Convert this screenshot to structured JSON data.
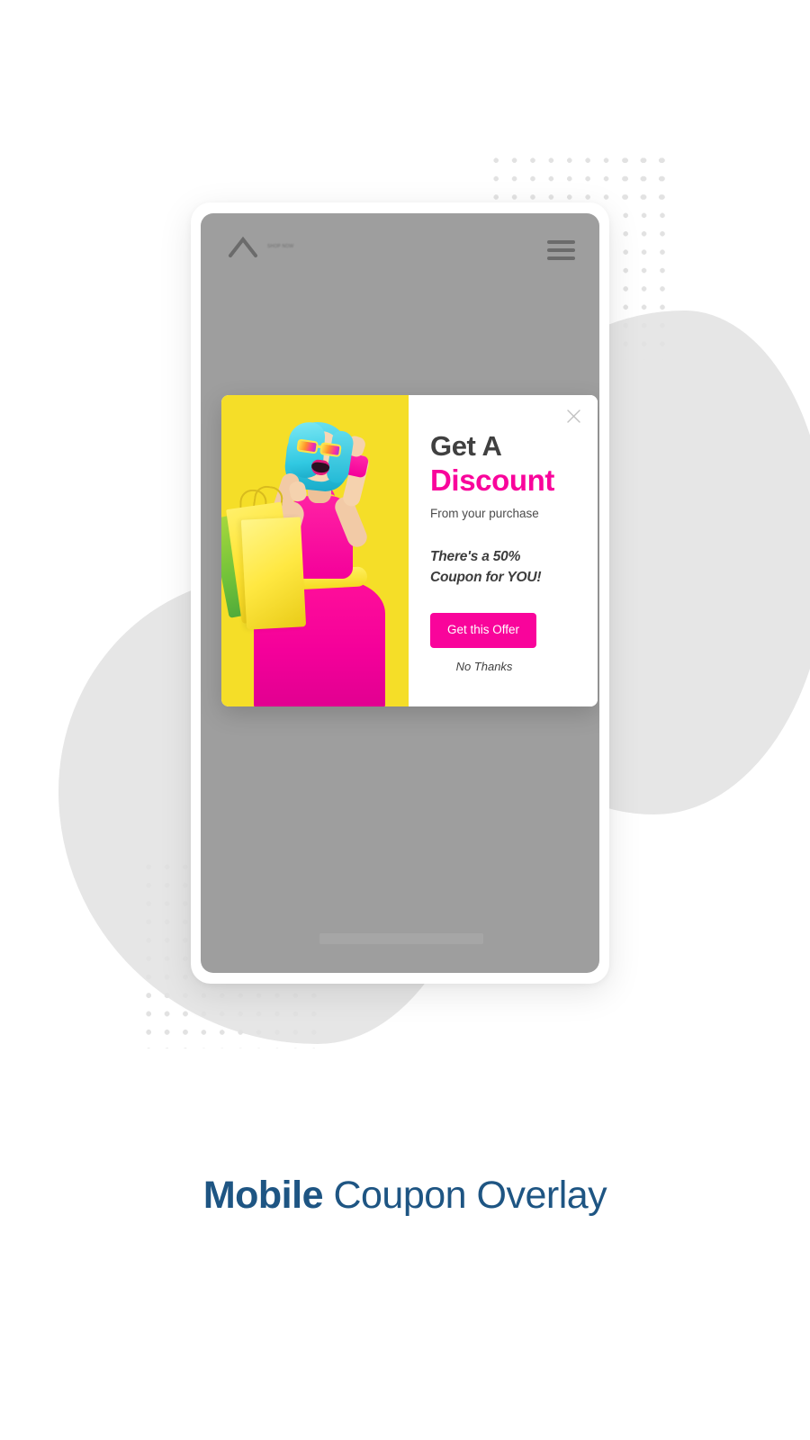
{
  "caption": {
    "bold_word": "Mobile",
    "rest": " Coupon Overlay"
  },
  "phone": {
    "site_header": {
      "logo_icon": "chevron-up-logo-icon",
      "wordmark_text": "SHOP NOW",
      "menu_icon": "hamburger-menu-icon"
    }
  },
  "modal": {
    "close_icon": "close-icon",
    "headline_line1": "Get A",
    "headline_line2": "Discount",
    "subline": "From your purchase",
    "offer_text": "There's a 50% Coupon for YOU!",
    "cta_label": "Get this Offer",
    "decline_label": "No Thanks",
    "image_alt": "woman-with-shopping-bags-photo"
  },
  "colors": {
    "accent_magenta": "#f9049b",
    "accent_yellow": "#f5de28",
    "caption_navy": "#1e5583",
    "screen_gray": "#9e9e9e",
    "blob_gray": "#e6e6e6",
    "dot_gray": "#e2e2e2"
  }
}
